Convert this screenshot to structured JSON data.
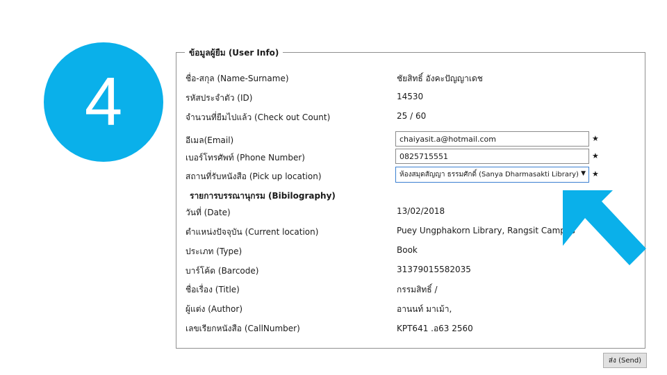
{
  "step": {
    "number": "4",
    "color": "#0ab0ea"
  },
  "user_info": {
    "legend": "ข้อมูลผู้ยืม (User Info)",
    "rows": [
      {
        "label": "ชื่อ-สกุล (Name-Surname)",
        "value": "ชัยสิทธิ์   อังคะปัญญาเดช"
      },
      {
        "label": "รหัสประจำตัว (ID)",
        "value": "14530"
      },
      {
        "label": "จำนวนที่ยืมไปแล้ว (Check out Count)",
        "value": "25 / 60"
      }
    ],
    "email": {
      "label": "อีเมล(Email)",
      "value": "chaiyasit.a@hotmail.com",
      "required": "★"
    },
    "phone": {
      "label": "เบอร์โทรศัพท์ (Phone Number)",
      "value": "0825715551",
      "required": "★"
    },
    "pickup": {
      "label": "สถานที่รับหนังสือ (Pick up location)",
      "selected": "ห้องสมุดสัญญา ธรรมศักดิ์ (Sanya Dharmasakti Library)",
      "required": "★"
    }
  },
  "bibliography": {
    "title": "รายการบรรณานุกรม (Bibilography)",
    "rows": [
      {
        "label": "วันที่ (Date)",
        "value": "13/02/2018"
      },
      {
        "label": "ตำแหน่งปัจจุบัน (Current location)",
        "value": "Puey Ungphakorn Library, Rangsit Campus"
      },
      {
        "label": "ประเภท (Type)",
        "value": "Book"
      },
      {
        "label": "บาร์โค้ด (Barcode)",
        "value": "31379015582035"
      },
      {
        "label": "ชื่อเรื่อง (Title)",
        "value": "กรรมสิทธิ์ /"
      },
      {
        "label": "ผู้แต่ง (Author)",
        "value": "อานนท์ มาเม้า,"
      },
      {
        "label": "เลขเรียกหนังสือ (CallNumber)",
        "value": "KPT641 .อ63 2560"
      }
    ]
  },
  "send_button": {
    "label": "ส่ง (Send)"
  },
  "pointer": {
    "icon": "big-arrow-pointer-icon",
    "color": "#0ab0ea"
  }
}
